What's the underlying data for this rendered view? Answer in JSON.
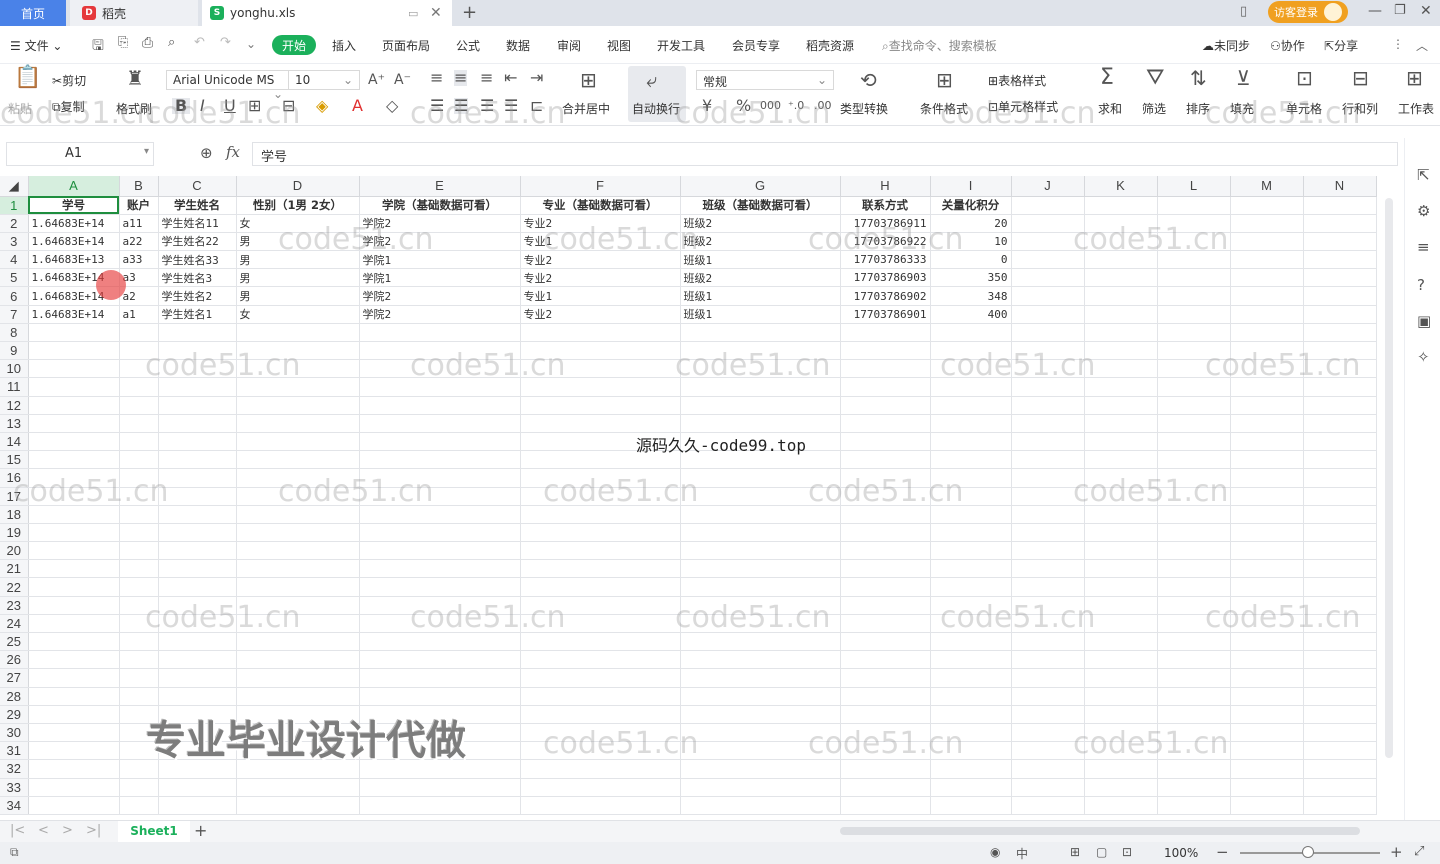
{
  "titlebar": {
    "tabs": [
      {
        "label": "首页"
      },
      {
        "label": "稻壳"
      },
      {
        "label": "yonghu.xls"
      }
    ],
    "visitor_login": "访客登录"
  },
  "menubar": {
    "file": "文件",
    "items": [
      "开始",
      "插入",
      "页面布局",
      "公式",
      "数据",
      "审阅",
      "视图",
      "开发工具",
      "会员专享",
      "稻壳资源"
    ],
    "search_placeholder": "查找命令、搜索模板",
    "unsync": "未同步",
    "collab": "协作",
    "share": "分享"
  },
  "ribbon": {
    "paste": "粘贴",
    "cut": "剪切",
    "copy": "复制",
    "format_painter": "格式刷",
    "font_name": "Arial Unicode MS",
    "font_size": "10",
    "merge_center": "合并居中",
    "wrap_text": "自动换行",
    "number_format": "常规",
    "type_convert": "类型转换",
    "conditional_format": "条件格式",
    "table_style": "表格样式",
    "cell_style": "单元格样式",
    "sum": "求和",
    "filter": "筛选",
    "sort": "排序",
    "fill": "填充",
    "cell": "单元格",
    "row_col": "行和列",
    "worksheet": "工作表"
  },
  "formulabar": {
    "cell_ref": "A1",
    "fx": "fx",
    "content": "学号"
  },
  "columns": [
    "A",
    "B",
    "C",
    "D",
    "E",
    "F",
    "G",
    "H",
    "I",
    "J",
    "K",
    "L",
    "M",
    "N"
  ],
  "headers": [
    "学号",
    "账户",
    "学生姓名",
    "性别（1男 2女）",
    "学院（基础数据可看）",
    "专业（基础数据可看）",
    "班级（基础数据可看）",
    "联系方式",
    "关量化积分"
  ],
  "rows": [
    [
      "1.64683E+14",
      "a11",
      "学生姓名11",
      "女",
      "学院2",
      "专业2",
      "班级2",
      "17703786911",
      "20"
    ],
    [
      "1.64683E+14",
      "a22",
      "学生姓名22",
      "男",
      "学院2",
      "专业1",
      "班级2",
      "17703786922",
      "10"
    ],
    [
      "1.64683E+13",
      "a33",
      "学生姓名33",
      "男",
      "学院1",
      "专业2",
      "班级1",
      "17703786333",
      "0"
    ],
    [
      "1.64683E+14",
      "a3",
      "学生姓名3",
      "男",
      "学院1",
      "专业2",
      "班级2",
      "17703786903",
      "350"
    ],
    [
      "1.64683E+14",
      "a2",
      "学生姓名2",
      "男",
      "学院2",
      "专业1",
      "班级1",
      "17703786902",
      "348"
    ],
    [
      "1.64683E+14",
      "a1",
      "学生姓名1",
      "女",
      "学院2",
      "专业2",
      "班级1",
      "17703786901",
      "400"
    ]
  ],
  "empty_row_count": 27,
  "overlay": {
    "site_text": "源码久久-code99.top",
    "promo_text": "专业毕业设计代做",
    "watermark": "code51.cn"
  },
  "sheetbar": {
    "sheet_name": "Sheet1",
    "add": "+"
  },
  "statusbar": {
    "zoom": "100%"
  },
  "colors": {
    "home_tab": "#4a82e8",
    "start_button": "#1bb05b",
    "login_badge": "#f0a020",
    "selection": "#1e8e3e"
  }
}
